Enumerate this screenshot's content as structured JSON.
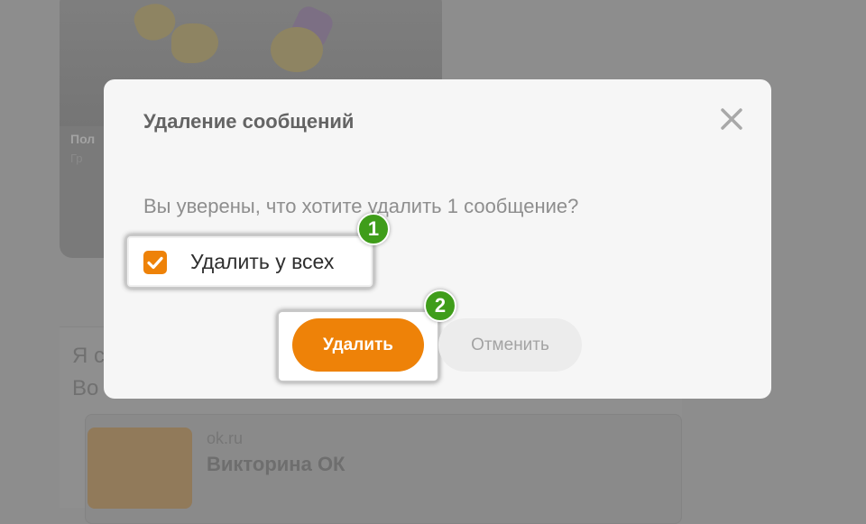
{
  "background": {
    "card_title": "Пол",
    "card_subtitle": "Гр",
    "post_text_line1": "Я с",
    "post_text_line2": "Во",
    "link_domain": "ok.ru",
    "link_title": "Викторина ОК"
  },
  "dialog": {
    "title": "Удаление сообщений",
    "question": "Вы уверены, что хотите удалить 1 сообщение?",
    "checkbox_label": "Удалить у всех",
    "checkbox_checked": true,
    "delete_label": "Удалить",
    "cancel_label": "Отменить",
    "close_icon": "close-icon"
  },
  "annotations": {
    "badge_1": "1",
    "badge_2": "2"
  },
  "colors": {
    "accent": "#ee8208",
    "badge": "#3f9d1a",
    "overlay": "#8d8d8d"
  }
}
